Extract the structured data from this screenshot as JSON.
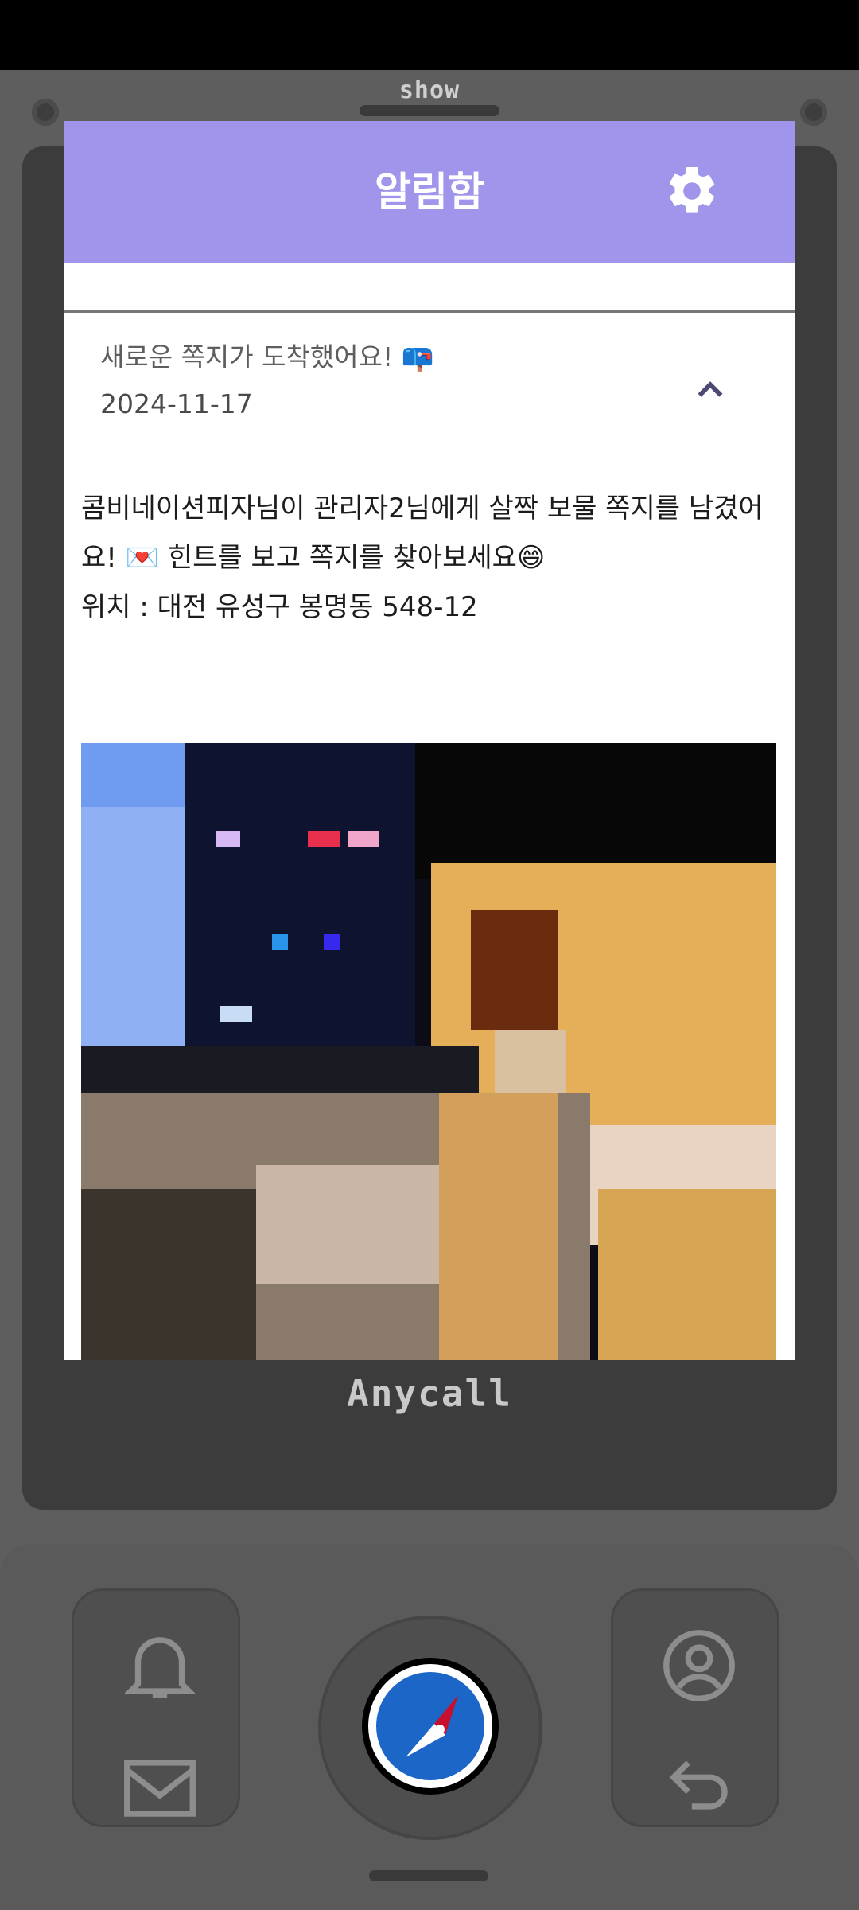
{
  "device": {
    "top_label": "show",
    "brand": "Anycall"
  },
  "header": {
    "title": "알림함",
    "settings_icon": "gear-icon"
  },
  "notification": {
    "title": "새로운 쪽지가 도착했어요! 📪",
    "date": "2024-11-17",
    "collapse_icon": "chevron-up-icon",
    "message_line1": "콤비네이션피자님이 관리자2님에게 살짝 보물 쪽지를 남겼어요! 💌 힌트를 보고 쪽지를 찾아보세요😄",
    "location": "위치 : 대전 유성구 봉명동 548-12"
  },
  "keypad": {
    "left_top_icon": "bell-icon",
    "left_bottom_icon": "mail-icon",
    "center_icon": "compass-icon",
    "right_top_icon": "profile-icon",
    "right_bottom_icon": "back-arrow-icon"
  },
  "colors": {
    "header": "#9f95ea",
    "phone_body": "#5e5e5e",
    "bezel": "#3c3c3c"
  }
}
